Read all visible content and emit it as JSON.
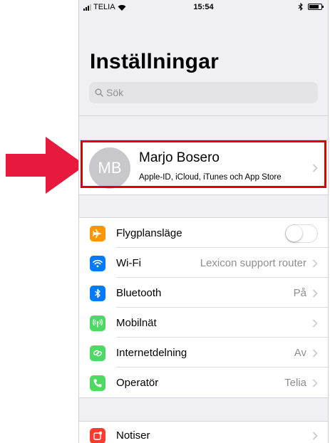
{
  "status_bar": {
    "carrier": "TELIA",
    "time": "15:54"
  },
  "page_title": "Inställningar",
  "search": {
    "placeholder": "Sök"
  },
  "profile": {
    "initials": "MB",
    "name": "Marjo Bosero",
    "subtitle": "Apple-ID, iCloud, iTunes och App Store"
  },
  "settings": [
    {
      "id": "airplane",
      "label": "Flygplansläge",
      "value": "",
      "icon": "airplane-icon",
      "color": "#ff9500",
      "control": "toggle",
      "toggle_on": false
    },
    {
      "id": "wifi",
      "label": "Wi-Fi",
      "value": "Lexicon support router",
      "icon": "wifi-icon",
      "color": "#007aff",
      "control": "chevron"
    },
    {
      "id": "bluetooth",
      "label": "Bluetooth",
      "value": "På",
      "icon": "bluetooth-icon",
      "color": "#007aff",
      "control": "chevron"
    },
    {
      "id": "mobile",
      "label": "Mobilnät",
      "value": "",
      "icon": "antenna-icon",
      "color": "#4cd964",
      "control": "chevron"
    },
    {
      "id": "hotspot",
      "label": "Internetdelning",
      "value": "Av",
      "icon": "link-icon",
      "color": "#4cd964",
      "control": "chevron"
    },
    {
      "id": "carrier",
      "label": "Operatör",
      "value": "Telia",
      "icon": "phone-icon",
      "color": "#4cd964",
      "control": "chevron"
    }
  ],
  "notifications": {
    "label": "Notiser",
    "icon": "notifications-icon",
    "color": "#ff3b30"
  },
  "colors": {
    "highlight": "#e00000",
    "arrow": "#e8193c"
  }
}
